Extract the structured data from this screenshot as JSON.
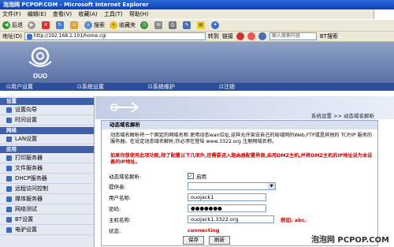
{
  "window": {
    "title": "泡泡网 PCPOP.COM - Microsoft Internet Explorer"
  },
  "menu": [
    "文件(F)",
    "编辑(E)",
    "查看(V)",
    "收藏(A)",
    "工具(T)",
    "帮助(H)"
  ],
  "toolbar": {
    "back": "后退",
    "search": "搜索",
    "favorites": "收藏夹"
  },
  "address": {
    "url": "http://192.168.1.101/home.cgi",
    "go": "转到",
    "links": "链接",
    "search_placeholder": "输入搜索内容",
    "bt": "BT搜索"
  },
  "brand": {
    "logo_text": "OUO"
  },
  "nav": [
    "用户设置",
    "系统设置",
    "系统维护",
    "注销"
  ],
  "sidebar": {
    "sections": [
      {
        "title": "设置",
        "items": [
          "设置向导",
          "时间设置"
        ]
      },
      {
        "title": "网络",
        "items": [
          "LAN设置"
        ]
      },
      {
        "title": "应用",
        "items": [
          "打印服务器",
          "文件服务器",
          "DHCP服务器",
          "远程访问控制",
          "媒体服务器",
          "网络测试",
          "BT设置",
          "电驴设置"
        ]
      }
    ]
  },
  "breadcrumb": "系统设置 >> 动态域名解析",
  "form": {
    "title": "动态域名解析",
    "description": "动态域名解析将一个固定的网域名称,使用动态wan位址,这样允许架设自己的局域网的Web,FTP或是其他的 TCP/IP 服务的服务器。在设定动态域名解析,你必须在登陆 www.3322.org 注册网域名称。",
    "warning": "如果你想使用此项功能,除了配置以下几项外,还需要进入路由器配置界面,启用DMZ主机,并将DMZ主机的IP地址设为本设备的IP地址。",
    "enable_label": "动态域名解析:",
    "enable_value": "启用",
    "provider_label": "提供者:",
    "provider_value": "",
    "username_label": "用户名称:",
    "username_value": "ouojack1",
    "password_label": "密码:",
    "password_value": "●●●●●●●",
    "host_label": "主机名称:",
    "host_value": "ouojack1.3322.org",
    "host_example": "例如: abc.",
    "status_label": "状态:",
    "status_value": "connecting",
    "save_button": "保存",
    "refresh_button": "刷新"
  },
  "watermark": "泡泡网 PCPOP.COM"
}
